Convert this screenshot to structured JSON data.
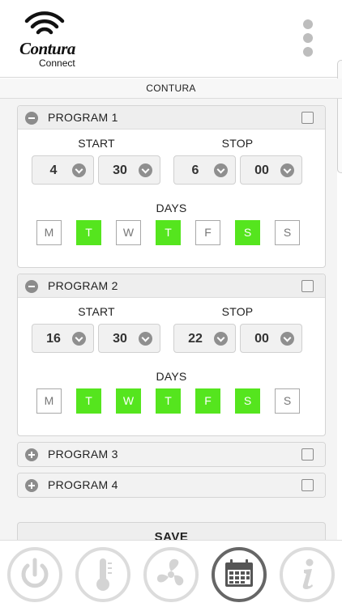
{
  "header": {
    "logo_title": "Contura",
    "logo_subtitle": "Connect",
    "menu_icon": "more-vertical-icon"
  },
  "subtitle": "CONTURA",
  "labels": {
    "start": "START",
    "stop": "STOP",
    "days": "DAYS"
  },
  "programs": [
    {
      "title": "PROGRAM 1",
      "expanded": true,
      "enabled": false,
      "start_hour": "4",
      "start_min": "30",
      "stop_hour": "6",
      "stop_min": "00",
      "days": [
        {
          "label": "M",
          "on": false
        },
        {
          "label": "T",
          "on": true
        },
        {
          "label": "W",
          "on": false
        },
        {
          "label": "T",
          "on": true
        },
        {
          "label": "F",
          "on": false
        },
        {
          "label": "S",
          "on": true
        },
        {
          "label": "S",
          "on": false
        }
      ]
    },
    {
      "title": "PROGRAM 2",
      "expanded": true,
      "enabled": false,
      "start_hour": "16",
      "start_min": "30",
      "stop_hour": "22",
      "stop_min": "00",
      "days": [
        {
          "label": "M",
          "on": false
        },
        {
          "label": "T",
          "on": true
        },
        {
          "label": "W",
          "on": true
        },
        {
          "label": "T",
          "on": true
        },
        {
          "label": "F",
          "on": true
        },
        {
          "label": "S",
          "on": true
        },
        {
          "label": "S",
          "on": false
        }
      ]
    },
    {
      "title": "PROGRAM 3",
      "expanded": false,
      "enabled": false
    },
    {
      "title": "PROGRAM 4",
      "expanded": false,
      "enabled": false
    }
  ],
  "save_label": "SAVE",
  "nav": [
    {
      "icon": "power-icon",
      "active": false
    },
    {
      "icon": "thermometer-icon",
      "active": false
    },
    {
      "icon": "fan-icon",
      "active": false
    },
    {
      "icon": "calendar-icon",
      "active": true
    },
    {
      "icon": "info-icon",
      "active": false
    }
  ],
  "colors": {
    "day_active": "#55e51e",
    "nav_active": "#666666",
    "nav_inactive": "#dcdcdc"
  }
}
